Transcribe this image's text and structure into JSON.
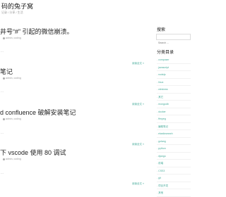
{
  "site": {
    "title": "码的兔子窝",
    "subtitle": "记录 / 分享 / 生活"
  },
  "posts": [
    {
      "title": "井号“#” 引起的微信崩溃。",
      "meta": "admin, coding",
      "excerpt": "…",
      "more": "阅读全文 »"
    },
    {
      "title": "笔记",
      "meta": "admin, coding",
      "excerpt": "…",
      "more": "阅读全文 »"
    },
    {
      "title": "d confluence 破解安装笔记",
      "meta": "admin, coding",
      "excerpt": "…",
      "more": "阅读全文 »"
    },
    {
      "title": "下 vscode 使用 80 调试",
      "meta": "admin, coding",
      "excerpt": "…",
      "more": "阅读全文 »"
    }
  ],
  "sidebar": {
    "search_title": "搜索",
    "search_placeholder": "Search ...",
    "categories_title": "分类目录",
    "categories": [
      "composer",
      "javascript",
      "nodejs",
      "linux",
      "windows",
      "其它",
      "mongodb",
      "docker",
      "ffmpeg",
      "编程笔记",
      "elasticsearch",
      "golang",
      "python",
      "django",
      "前端",
      "CSS3",
      "git",
      "项目开发",
      "其他"
    ]
  }
}
